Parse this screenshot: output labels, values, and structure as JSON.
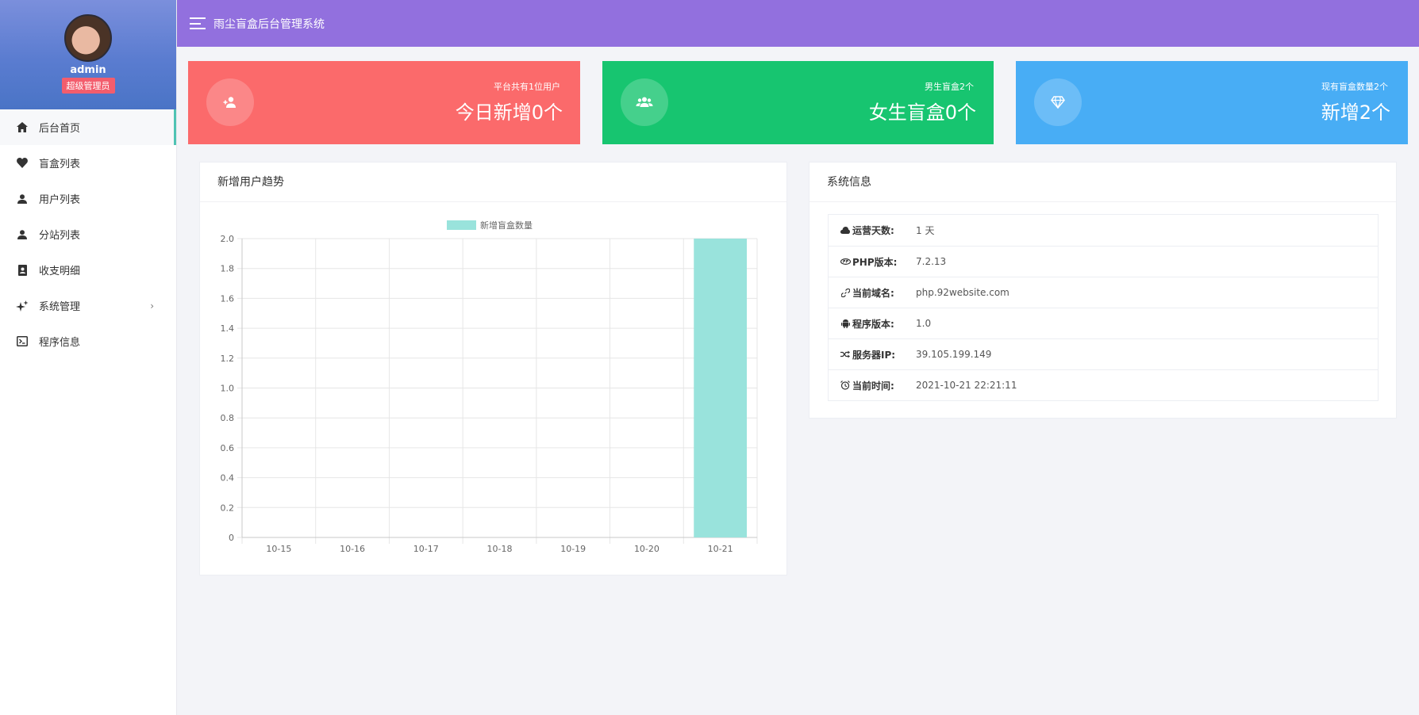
{
  "app": {
    "title": "雨尘盲盒后台管理系统"
  },
  "profile": {
    "username": "admin",
    "role": "超级管理员"
  },
  "sidebar": {
    "items": [
      {
        "label": "后台首页",
        "icon": "home-icon",
        "active": true
      },
      {
        "label": "盲盒列表",
        "icon": "heart-icon"
      },
      {
        "label": "用户列表",
        "icon": "user-icon"
      },
      {
        "label": "分站列表",
        "icon": "user-icon"
      },
      {
        "label": "收支明细",
        "icon": "contact-book-icon"
      },
      {
        "label": "系统管理",
        "icon": "sparkle-icon",
        "has_submenu": true,
        "arrow": "›"
      },
      {
        "label": "程序信息",
        "icon": "terminal-icon"
      }
    ]
  },
  "cards": [
    {
      "subtitle": "平台共有1位用户",
      "main": "今日新增0个",
      "icon": "add-user-icon",
      "color": "#fb6a6b"
    },
    {
      "subtitle": "男生盲盒2个",
      "main": "女生盲盒0个",
      "icon": "users-icon",
      "color": "#17c570"
    },
    {
      "subtitle": "现有盲盒数量2个",
      "main": "新增2个",
      "icon": "diamond-icon",
      "color": "#48adf5"
    }
  ],
  "chart_panel": {
    "title": "新增用户趋势"
  },
  "chart_data": {
    "type": "bar",
    "categories": [
      "10-15",
      "10-16",
      "10-17",
      "10-18",
      "10-19",
      "10-20",
      "10-21"
    ],
    "series": [
      {
        "name": "新增盲盒数量",
        "values": [
          0,
          0,
          0,
          0,
          0,
          0,
          2
        ],
        "color": "#99e3dc"
      }
    ],
    "ylim": [
      0,
      2
    ],
    "yticks": [
      "0",
      "0.2",
      "0.4",
      "0.6",
      "0.8",
      "1.0",
      "1.2",
      "1.4",
      "1.6",
      "1.8",
      "2.0"
    ],
    "grid": true,
    "legend": "top-center"
  },
  "info_panel": {
    "title": "系统信息",
    "rows": [
      {
        "icon": "cloud-icon",
        "label": "运营天数:",
        "value": "1 天"
      },
      {
        "icon": "php-icon",
        "label": "PHP版本:",
        "value": "7.2.13"
      },
      {
        "icon": "link-icon",
        "label": "当前域名:",
        "value": "php.92website.com"
      },
      {
        "icon": "android-icon",
        "label": "程序版本:",
        "value": "1.0"
      },
      {
        "icon": "shuffle-icon",
        "label": "服务器IP:",
        "value": "39.105.199.149"
      },
      {
        "icon": "alarm-icon",
        "label": "当前时间:",
        "value": "2021-10-21 22:21:11"
      }
    ]
  }
}
